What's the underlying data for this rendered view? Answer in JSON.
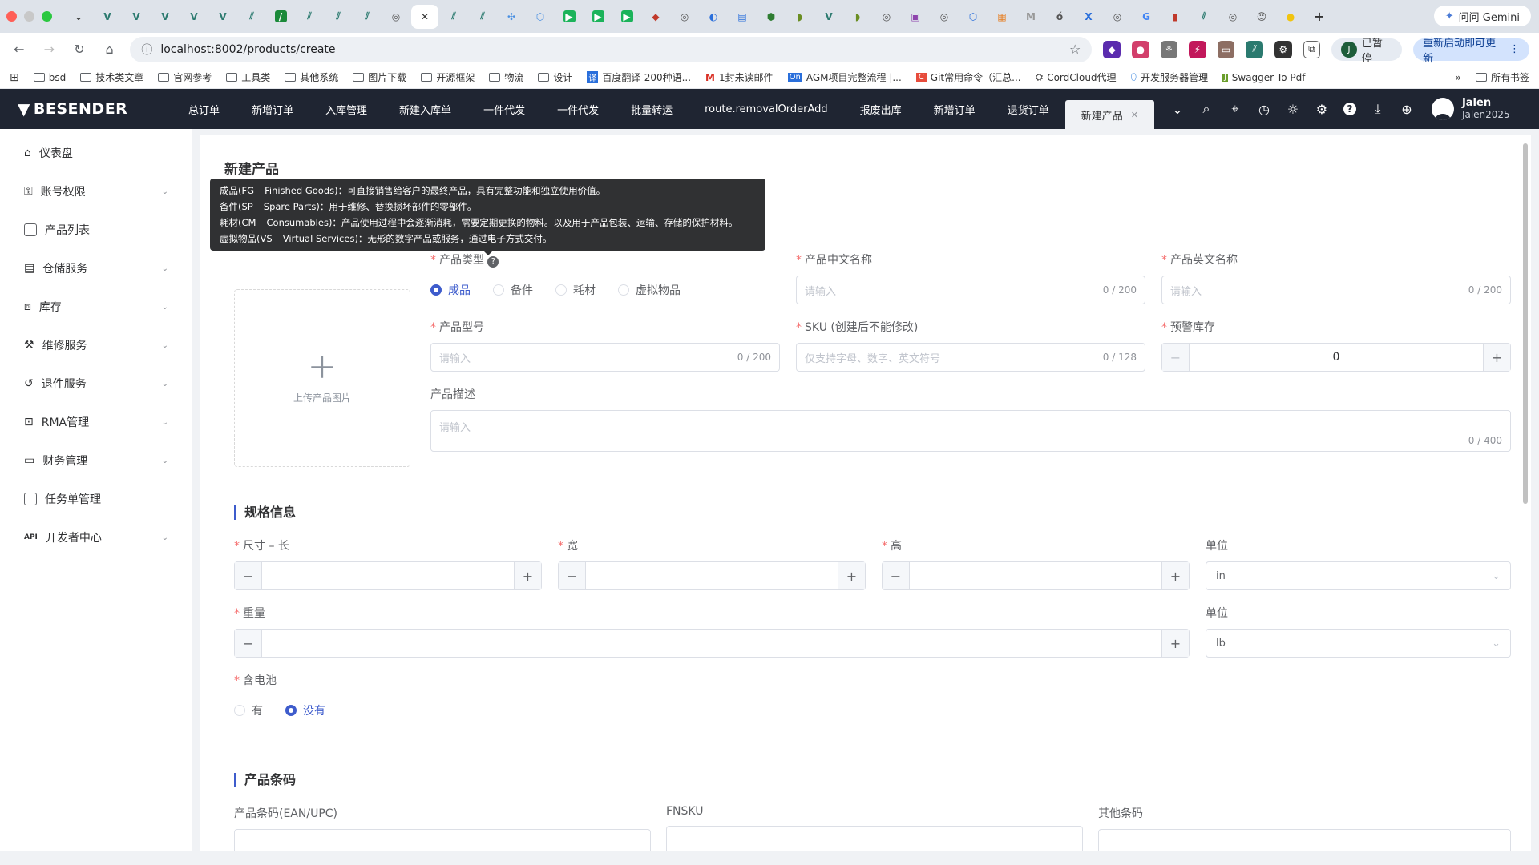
{
  "browser": {
    "gemini_label": "问问 Gemini",
    "url": "localhost:8002/products/create",
    "paused_label": "已暂停",
    "restart_label": "重新启动即可更新",
    "profile_initial": "J",
    "bookmarks": [
      "bsd",
      "技术类文章",
      "官网参考",
      "工具类",
      "其他系统",
      "图片下载",
      "开源框架",
      "物流",
      "设计",
      "百度翻译-200种语...",
      "1封未读邮件",
      "AGM项目完整流程 |...",
      "Git常用命令（汇总...",
      "CordCloud代理",
      "开发服务器管理",
      "Swagger To Pdf"
    ],
    "all_bookmarks": "所有书签"
  },
  "app": {
    "logo": "BESENDER",
    "tabs": [
      "总订单",
      "新增订单",
      "入库管理",
      "新建入库单",
      "一件代发",
      "一件代发",
      "批量转运",
      "route.removalOrderAdd",
      "报废出库",
      "新增订单",
      "退货订单"
    ],
    "active_tab": "新建产品",
    "user_name": "Jalen",
    "user_id": "Jalen2025"
  },
  "sidebar": {
    "items": [
      {
        "label": "仪表盘",
        "expand": false
      },
      {
        "label": "账号权限",
        "expand": true
      },
      {
        "label": "产品列表",
        "expand": false
      },
      {
        "label": "仓储服务",
        "expand": true
      },
      {
        "label": "库存",
        "expand": true
      },
      {
        "label": "维修服务",
        "expand": true
      },
      {
        "label": "退件服务",
        "expand": true
      },
      {
        "label": "RMA管理",
        "expand": true
      },
      {
        "label": "财务管理",
        "expand": true
      },
      {
        "label": "任务单管理",
        "expand": false
      },
      {
        "label": "开发者中心",
        "expand": true,
        "prefix": "API"
      }
    ]
  },
  "page": {
    "title": "新建产品",
    "tooltip": [
      "成品(FG – Finished Goods)：可直接销售给客户的最终产品，具有完整功能和独立使用价值。",
      "备件(SP – Spare Parts)：用于维修、替换损坏部件的零部件。",
      "耗材(CM – Consumables)：产品使用过程中会逐渐消耗，需要定期更换的物料。以及用于产品包装、运输、存储的保护材料。",
      "虚拟物品(VS – Virtual Services)：无形的数字产品或服务，通过电子方式交付。"
    ],
    "upload_label": "上传产品图片",
    "type_label": "产品类型",
    "type_options": [
      "成品",
      "备件",
      "耗材",
      "虚拟物品"
    ],
    "cn_name_label": "产品中文名称",
    "en_name_label": "产品英文名称",
    "model_label": "产品型号",
    "sku_label": "SKU (创建后不能修改)",
    "stock_label": "预警库存",
    "desc_label": "产品描述",
    "placeholder": "请输入",
    "sku_placeholder": "仅支持字母、数字、英文符号",
    "cnt_200": "0 / 200",
    "cnt_128": "0 / 128",
    "cnt_400": "0 / 400",
    "stock_value": "0"
  },
  "spec": {
    "title": "规格信息",
    "length_label": "尺寸 – 长",
    "width_label": "宽",
    "height_label": "高",
    "unit_label": "单位",
    "size_unit": "in",
    "weight_label": "重量",
    "weight_unit": "lb",
    "battery_label": "含电池",
    "battery_yes": "有",
    "battery_no": "没有"
  },
  "barcode": {
    "title": "产品条码",
    "ean_label": "产品条码(EAN/UPC)",
    "fnsku_label": "FNSKU",
    "other_label": "其他条码"
  }
}
